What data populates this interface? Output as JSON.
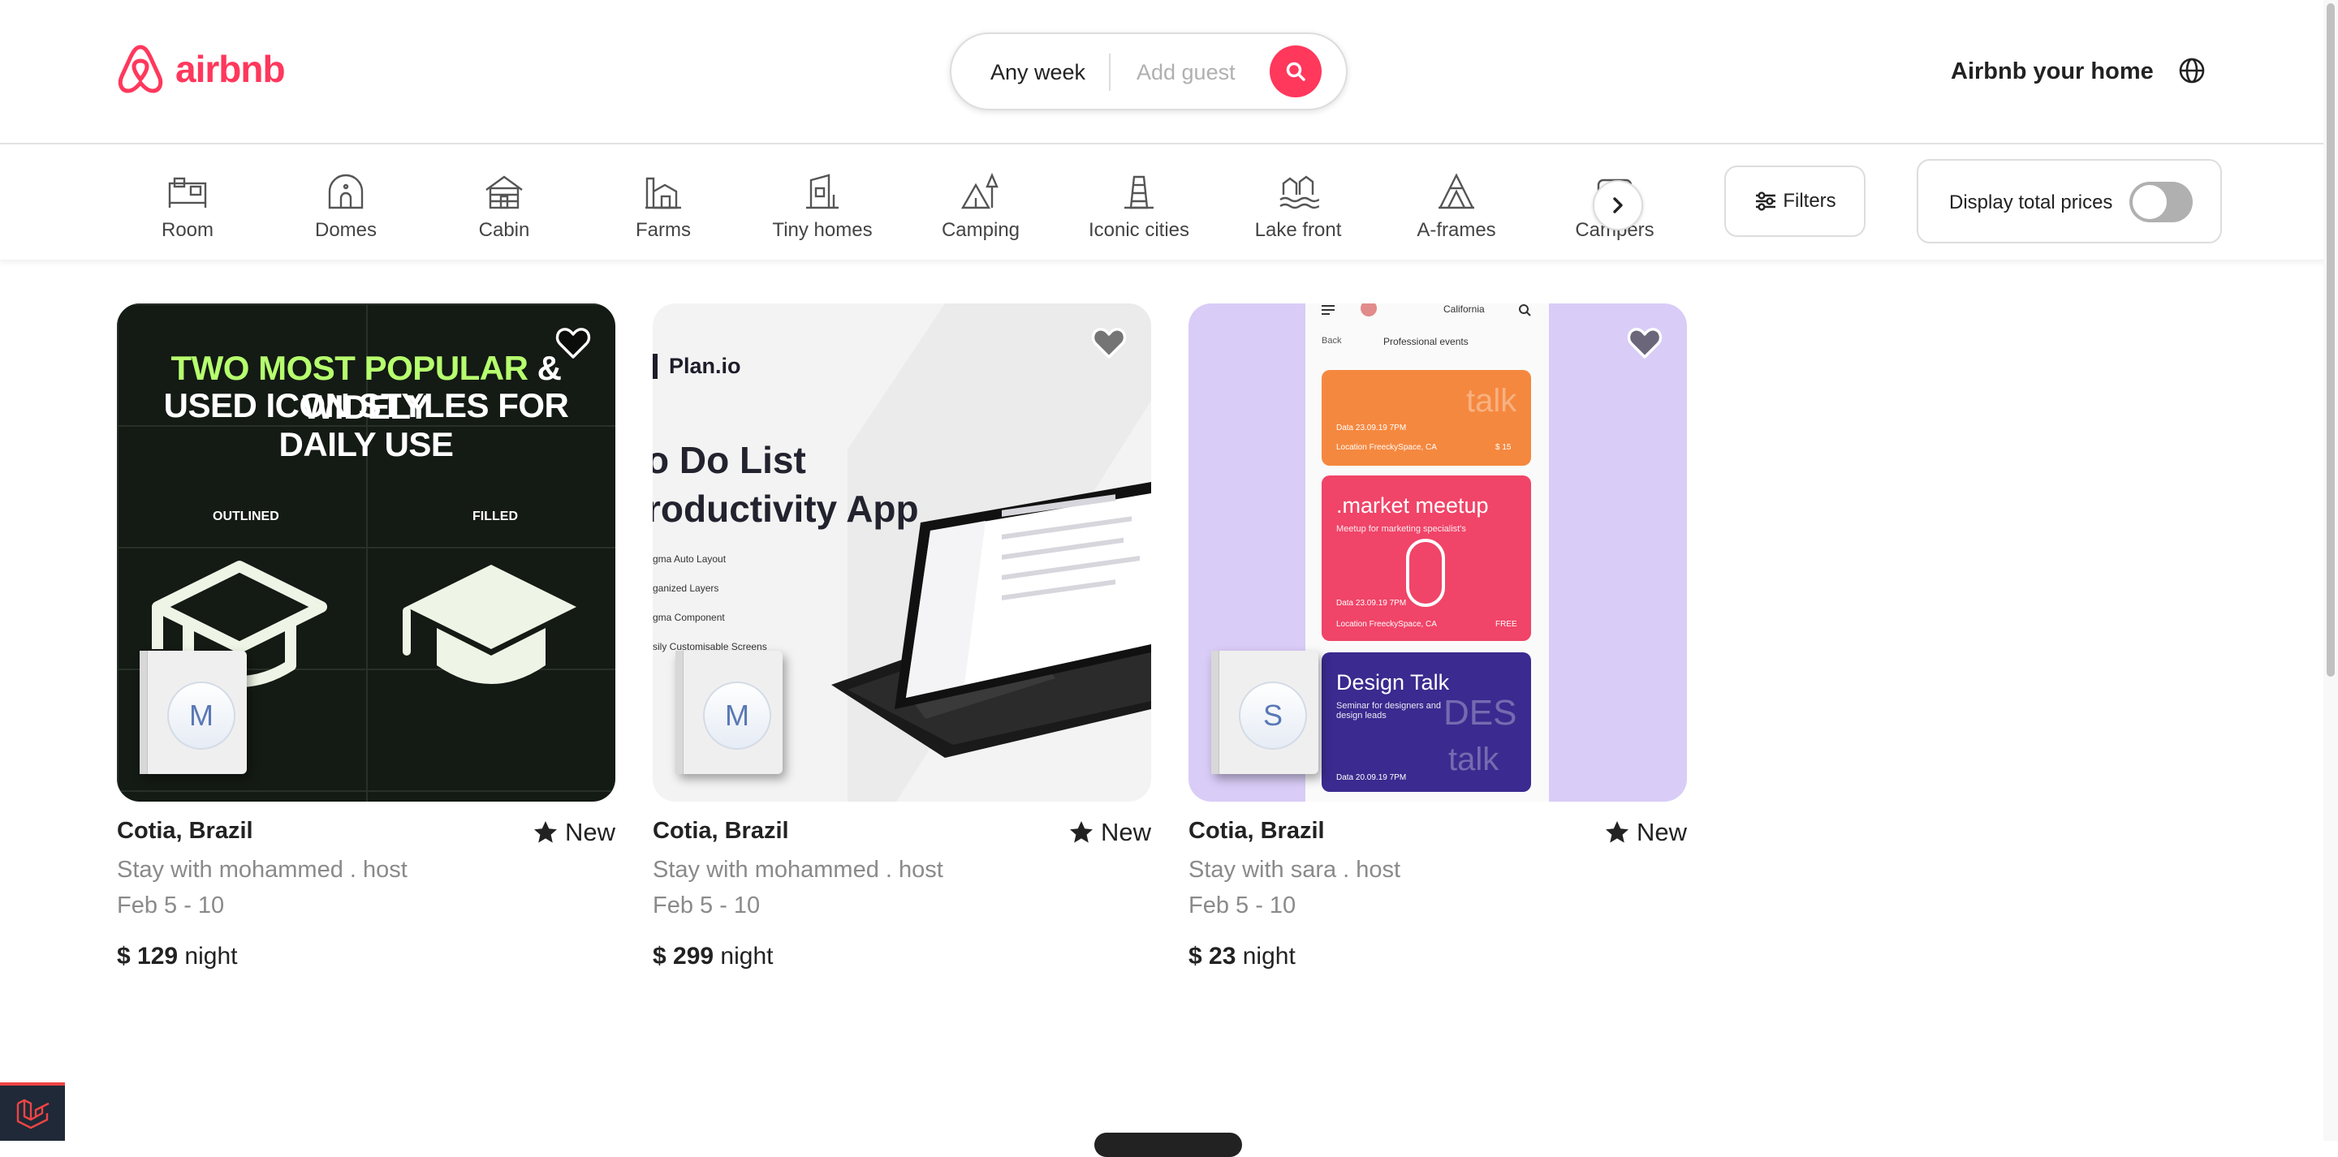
{
  "header": {
    "logo_text": "airbnb",
    "search": {
      "week": "Any week",
      "guest_placeholder": "Add guest"
    },
    "host_link": "Airbnb your home"
  },
  "categories": {
    "items": [
      {
        "label": "Room",
        "icon": "room-icon"
      },
      {
        "label": "Domes",
        "icon": "dome-icon"
      },
      {
        "label": "Cabin",
        "icon": "cabin-icon"
      },
      {
        "label": "Farms",
        "icon": "farm-icon"
      },
      {
        "label": "Tiny homes",
        "icon": "tiny-home-icon"
      },
      {
        "label": "Camping",
        "icon": "camping-icon"
      },
      {
        "label": "Iconic cities",
        "icon": "iconic-city-icon"
      },
      {
        "label": "Lake front",
        "icon": "lake-front-icon"
      },
      {
        "label": "A-frames",
        "icon": "a-frame-icon"
      },
      {
        "label": "Campers",
        "icon": "camper-icon"
      }
    ],
    "filters_label": "Filters",
    "total_prices_label": "Display total prices"
  },
  "listings": [
    {
      "location": "Cotia, Brazil",
      "rating": "New",
      "host": "Stay with mohammed . host",
      "dates": "Feb 5 - 10",
      "price": "$ 129",
      "unit": "night",
      "avatar": "M",
      "image": {
        "line1_green": "TWO MOST POPULAR",
        "line1_white": " & WIDELY",
        "line2": "USED ICON STYLES FOR DAILY USE",
        "label_left": "OUTLINED",
        "label_right": "FILLED"
      }
    },
    {
      "location": "Cotia, Brazil",
      "rating": "New",
      "host": "Stay with mohammed . host",
      "dates": "Feb 5 - 10",
      "price": "$ 299",
      "unit": "night",
      "avatar": "M",
      "image": {
        "brand": "Plan.io",
        "headline1": "o Do List",
        "headline2": "roductivity App",
        "features": [
          "gma Auto Layout",
          "ganized Layers",
          "gma Component",
          "sily Customisable Screens"
        ]
      }
    },
    {
      "location": "Cotia, Brazil",
      "rating": "New",
      "host": "Stay with sara . host",
      "dates": "Feb 5 - 10",
      "price": "$ 23",
      "unit": "night",
      "avatar": "S",
      "image": {
        "top_bar_location": "California",
        "back_label": "Back",
        "screen_title": "Professional events",
        "event1_date": "Data   23.09.19 7PM",
        "event1_location": "Location   FreeckySpace, CA",
        "event1_price": "$ 15",
        "event2_title": ".market meetup",
        "event2_sub": "Meetup for marketing specialist's",
        "event2_date": "Data   23.09.19 7PM",
        "event2_location": "Location   FreeckySpace, CA",
        "event2_price": "FREE",
        "event3_title": "Design Talk",
        "event3_sub": "Seminar for designers and design leads",
        "event3_date": "Data   20.09.19 7PM"
      }
    }
  ],
  "colors": {
    "brand": "#ff385c",
    "text": "#222222",
    "muted": "#8a8a8a"
  }
}
